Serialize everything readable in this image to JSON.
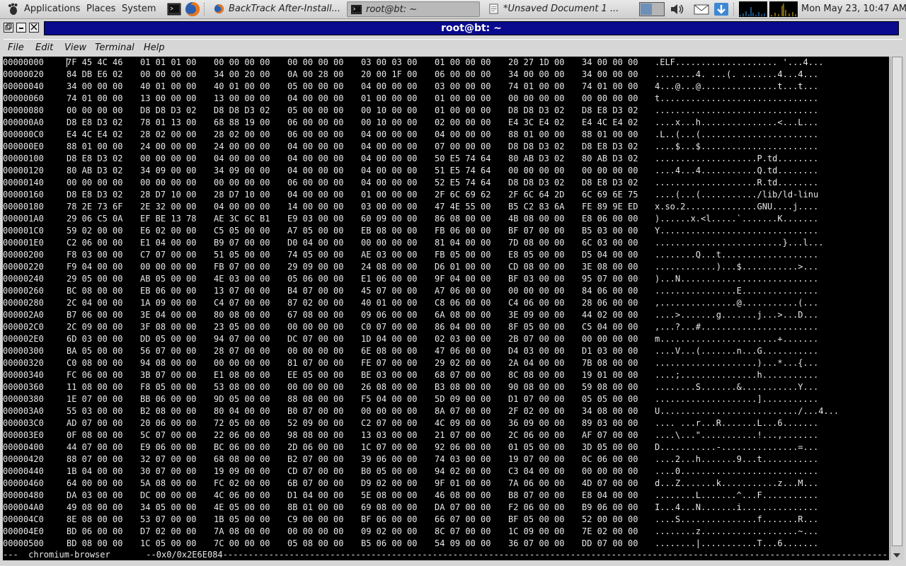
{
  "panel": {
    "menus": [
      "Applications",
      "Places",
      "System"
    ],
    "tasks": [
      {
        "label": "BackTrack After-Install...",
        "icon": "firefox-icon",
        "active": false
      },
      {
        "label": "root@bt: ~",
        "icon": "terminal-icon",
        "active": true
      },
      {
        "label": "*Unsaved Document 1 ...",
        "icon": "text-editor-icon",
        "active": false
      }
    ],
    "clock": "Mon May 23, 10:47 AM"
  },
  "window": {
    "title": "root@bt: ~",
    "menu": [
      "File",
      "Edit",
      "View",
      "Terminal",
      "Help"
    ]
  },
  "hexdump": {
    "rows": [
      {
        "addr": "00000000",
        "hex": [
          "7F 45 4C 46",
          "01 01 01 00",
          "00 00 00 00",
          "00 00 00 00",
          "03 00 03 00",
          "01 00 00 00",
          "20 27 1D 00",
          "34 00 00 00"
        ],
        "ascii": ".ELF.................... '...4..."
      },
      {
        "addr": "00000020",
        "hex": [
          "84 DB E6 02",
          "00 00 00 00",
          "34 00 20 00",
          "0A 00 28 00",
          "20 00 1F 00",
          "06 00 00 00",
          "34 00 00 00",
          "34 00 00 00"
        ],
        "ascii": "........4. ...(. .......4...4..."
      },
      {
        "addr": "00000040",
        "hex": [
          "34 00 00 00",
          "40 01 00 00",
          "40 01 00 00",
          "05 00 00 00",
          "04 00 00 00",
          "03 00 00 00",
          "74 01 00 00",
          "74 01 00 00"
        ],
        "ascii": "4...@...@...............t...t..."
      },
      {
        "addr": "00000060",
        "hex": [
          "74 01 00 00",
          "13 00 00 00",
          "13 00 00 00",
          "04 00 00 00",
          "01 00 00 00",
          "01 00 00 00",
          "00 00 00 00",
          "00 00 00 00"
        ],
        "ascii": "t..............................."
      },
      {
        "addr": "00000080",
        "hex": [
          "00 00 00 00",
          "D8 D8 D3 02",
          "D8 D8 D3 02",
          "05 00 00 00",
          "00 10 00 00",
          "01 00 00 00",
          "D8 D8 D3 02",
          "D8 E8 D3 02"
        ],
        "ascii": "................................"
      },
      {
        "addr": "000000A0",
        "hex": [
          "D8 E8 D3 02",
          "78 01 13 00",
          "68 88 19 00",
          "06 00 00 00",
          "00 10 00 00",
          "02 00 00 00",
          "E4 3C E4 02",
          "E4 4C E4 02"
        ],
        "ascii": "....x...h...............<...L..."
      },
      {
        "addr": "000000C0",
        "hex": [
          "E4 4C E4 02",
          "28 02 00 00",
          "28 02 00 00",
          "06 00 00 00",
          "04 00 00 00",
          "04 00 00 00",
          "88 01 00 00",
          "88 01 00 00"
        ],
        "ascii": ".L..(...(......................."
      },
      {
        "addr": "000000E0",
        "hex": [
          "88 01 00 00",
          "24 00 00 00",
          "24 00 00 00",
          "04 00 00 00",
          "04 00 00 00",
          "07 00 00 00",
          "D8 D8 D3 02",
          "D8 E8 D3 02"
        ],
        "ascii": "....$...$......................."
      },
      {
        "addr": "00000100",
        "hex": [
          "D8 E8 D3 02",
          "00 00 00 00",
          "04 00 00 00",
          "04 00 00 00",
          "04 00 00 00",
          "50 E5 74 64",
          "80 AB D3 02",
          "80 AB D3 02"
        ],
        "ascii": "....................P.td........"
      },
      {
        "addr": "00000120",
        "hex": [
          "80 AB D3 02",
          "34 09 00 00",
          "34 09 00 00",
          "04 00 00 00",
          "04 00 00 00",
          "51 E5 74 64",
          "00 00 00 00",
          "00 00 00 00"
        ],
        "ascii": "....4...4...........Q.td........"
      },
      {
        "addr": "00000140",
        "hex": [
          "00 00 00 00",
          "00 00 00 00",
          "00 00 00 00",
          "06 00 00 00",
          "04 00 00 00",
          "52 E5 74 64",
          "D8 D8 D3 02",
          "D8 E8 D3 02"
        ],
        "ascii": "....................R.td........"
      },
      {
        "addr": "00000160",
        "hex": [
          "D8 E8 D3 02",
          "28 D7 10 00",
          "28 D7 10 00",
          "04 00 00 00",
          "01 00 00 00",
          "2F 6C 69 62",
          "2F 6C 64 2D",
          "6C 69 6E 75"
        ],
        "ascii": "....(...(.........../lib/ld-linu"
      },
      {
        "addr": "00000180",
        "hex": [
          "78 2E 73 6F",
          "2E 32 00 00",
          "04 00 00 00",
          "14 00 00 00",
          "03 00 00 00",
          "47 4E 55 00",
          "B5 C2 83 6A",
          "FE 89 9E ED"
        ],
        "ascii": "x.so.2..............GNU....j...."
      },
      {
        "addr": "000001A0",
        "hex": [
          "29 06 C5 0A",
          "EF BE 13 78",
          "AE 3C 6C B1",
          "E9 03 00 00",
          "60 09 00 00",
          "86 08 00 00",
          "4B 08 00 00",
          "E8 06 00 00"
        ],
        "ascii": ")......x.<l.....`.......K......."
      },
      {
        "addr": "000001C0",
        "hex": [
          "59 02 00 00",
          "E6 02 00 00",
          "C5 05 00 00",
          "A7 05 00 00",
          "EB 08 00 00",
          "FB 06 00 00",
          "BF 07 00 00",
          "B5 03 00 00"
        ],
        "ascii": "Y..............................."
      },
      {
        "addr": "000001E0",
        "hex": [
          "C2 06 00 00",
          "E1 04 00 00",
          "B9 07 00 00",
          "D0 04 00 00",
          "00 00 00 00",
          "81 04 00 00",
          "7D 08 00 00",
          "6C 03 00 00"
        ],
        "ascii": ".........................}...l..."
      },
      {
        "addr": "00000200",
        "hex": [
          "F8 03 00 00",
          "C7 07 00 00",
          "51 05 00 00",
          "74 05 00 00",
          "AE 03 00 00",
          "FB 05 00 00",
          "E8 05 00 00",
          "D5 04 00 00"
        ],
        "ascii": "........Q...t..................."
      },
      {
        "addr": "00000220",
        "hex": [
          "F9 04 00 00",
          "00 00 00 00",
          "FB 07 00 00",
          "29 09 00 00",
          "24 08 00 00",
          "D6 01 00 00",
          "CD 08 00 00",
          "3E 08 00 00"
        ],
        "ascii": "............)...$...........>..."
      },
      {
        "addr": "00000240",
        "hex": [
          "29 05 00 00",
          "AB 05 00 00",
          "4E 03 00 00",
          "05 06 00 00",
          "E1 06 00 00",
          "9F 04 00 00",
          "BF 03 00 00",
          "95 07 00 00"
        ],
        "ascii": ")...N..........................."
      },
      {
        "addr": "00000260",
        "hex": [
          "BC 08 00 00",
          "EB 06 00 00",
          "13 07 00 00",
          "B4 07 00 00",
          "45 07 00 00",
          "A7 06 00 00",
          "00 00 00 00",
          "84 06 00 00"
        ],
        "ascii": "................E..............."
      },
      {
        "addr": "00000280",
        "hex": [
          "2C 04 00 00",
          "1A 09 00 00",
          "C4 07 00 00",
          "87 02 00 00",
          "40 01 00 00",
          "C8 06 00 00",
          "C4 06 00 00",
          "28 06 00 00"
        ],
        "ascii": ",...............@...........(..."
      },
      {
        "addr": "000002A0",
        "hex": [
          "B7 06 00 00",
          "3E 04 00 00",
          "80 08 00 00",
          "67 08 00 00",
          "09 06 00 00",
          "6A 08 00 00",
          "3E 09 00 00",
          "44 02 00 00"
        ],
        "ascii": "....>.......g.......j...>...D..."
      },
      {
        "addr": "000002C0",
        "hex": [
          "2C 09 00 00",
          "3F 08 00 00",
          "23 05 00 00",
          "00 00 00 00",
          "C0 07 00 00",
          "86 04 00 00",
          "8F 05 00 00",
          "C5 04 00 00"
        ],
        "ascii": ",...?...#......................."
      },
      {
        "addr": "000002E0",
        "hex": [
          "6D 03 00 00",
          "DD 05 00 00",
          "94 07 00 00",
          "DC 07 00 00",
          "1D 04 00 00",
          "02 03 00 00",
          "2B 07 00 00",
          "00 00 00 00"
        ],
        "ascii": "m.......................+......."
      },
      {
        "addr": "00000300",
        "hex": [
          "BA 05 00 00",
          "56 07 00 00",
          "28 07 00 00",
          "00 00 00 00",
          "6E 08 00 00",
          "47 06 00 00",
          "D4 03 00 00",
          "D1 03 00 00"
        ],
        "ascii": "....V...(.......n...G..........."
      },
      {
        "addr": "00000320",
        "hex": [
          "C0 08 00 00",
          "94 08 00 00",
          "00 00 00 00",
          "81 07 00 00",
          "FE 07 00 00",
          "29 02 00 00",
          "2A 04 00 00",
          "7B 08 00 00"
        ],
        "ascii": "....................)...*...{..."
      },
      {
        "addr": "00000340",
        "hex": [
          "FC 06 00 00",
          "3B 07 00 00",
          "E1 08 00 00",
          "EE 05 00 00",
          "BE 03 00 00",
          "68 07 00 00",
          "8C 08 00 00",
          "19 01 00 00"
        ],
        "ascii": "....;...............h..........."
      },
      {
        "addr": "00000360",
        "hex": [
          "11 08 00 00",
          "F8 05 00 00",
          "53 08 00 00",
          "00 00 00 00",
          "26 08 00 00",
          "B3 08 00 00",
          "90 08 00 00",
          "59 08 00 00"
        ],
        "ascii": "........S.......&...........Y..."
      },
      {
        "addr": "00000380",
        "hex": [
          "1E 07 00 00",
          "BB 06 00 00",
          "9D 05 00 00",
          "88 08 00 00",
          "F5 04 00 00",
          "5D 09 00 00",
          "D1 07 00 00",
          "05 05 00 00"
        ],
        "ascii": "....................]..........."
      },
      {
        "addr": "000003A0",
        "hex": [
          "55 03 00 00",
          "B2 08 00 00",
          "80 04 00 00",
          "B0 07 00 00",
          "00 00 00 00",
          "8A 07 00 00",
          "2F 02 00 00",
          "34 08 00 00"
        ],
        "ascii": "U.........................../...4..."
      },
      {
        "addr": "000003C0",
        "hex": [
          "AD 07 00 00",
          "20 06 00 00",
          "72 05 00 00",
          "52 09 00 00",
          "C2 07 00 00",
          "4C 09 00 00",
          "36 09 00 00",
          "89 03 00 00"
        ],
        "ascii": ".... ...r...R.......L...6......."
      },
      {
        "addr": "000003E0",
        "hex": [
          "0F 08 00 00",
          "5C 07 00 00",
          "22 06 00 00",
          "98 08 00 00",
          "13 03 00 00",
          "21 07 00 00",
          "2C 06 00 00",
          "AF 07 00 00"
        ],
        "ascii": "....\\...\"...........!...,......."
      },
      {
        "addr": "00000400",
        "hex": [
          "44 07 00 00",
          "E9 06 00 00",
          "BC 06 00 00",
          "2D 06 00 00",
          "1C 07 00 00",
          "92 06 00 00",
          "01 05 00 00",
          "3D 05 00 00"
        ],
        "ascii": "D...........-...............=..."
      },
      {
        "addr": "00000420",
        "hex": [
          "88 07 00 00",
          "32 07 00 00",
          "68 08 00 00",
          "B2 07 00 00",
          "39 06 00 00",
          "74 03 00 00",
          "19 07 00 00",
          "0C 06 00 00"
        ],
        "ascii": "....2...h.......9...t..........."
      },
      {
        "addr": "00000440",
        "hex": [
          "1B 04 00 00",
          "30 07 00 00",
          "19 09 00 00",
          "CD 07 00 00",
          "B0 05 00 00",
          "94 02 00 00",
          "C3 04 00 00",
          "00 00 00 00"
        ],
        "ascii": "....0..........................."
      },
      {
        "addr": "00000460",
        "hex": [
          "64 00 00 00",
          "5A 08 00 00",
          "FC 02 00 00",
          "6B 07 00 00",
          "D9 02 00 00",
          "9F 01 00 00",
          "7A 06 00 00",
          "4D 07 00 00"
        ],
        "ascii": "d...Z.......k...........z...M..."
      },
      {
        "addr": "00000480",
        "hex": [
          "DA 03 00 00",
          "DC 00 00 00",
          "4C 06 00 00",
          "D1 04 00 00",
          "5E 08 00 00",
          "46 08 00 00",
          "B8 07 00 00",
          "E8 04 00 00"
        ],
        "ascii": "........L.......^...F..........."
      },
      {
        "addr": "000004A0",
        "hex": [
          "49 08 00 00",
          "34 05 00 00",
          "4E 05 00 00",
          "8B 01 00 00",
          "69 08 00 00",
          "DA 07 00 00",
          "F2 06 00 00",
          "B9 06 00 00"
        ],
        "ascii": "I...4...N.......i..............."
      },
      {
        "addr": "000004C0",
        "hex": [
          "8E 08 00 00",
          "53 07 00 00",
          "1B 05 00 00",
          "C9 00 00 00",
          "BF 06 00 00",
          "66 07 00 00",
          "BF 05 00 00",
          "52 00 00 00"
        ],
        "ascii": "....S...............f.......R..."
      },
      {
        "addr": "000004E0",
        "hex": [
          "BD 06 00 00",
          "D7 02 00 00",
          "7A 08 00 00",
          "00 00 00 00",
          "09 02 00 00",
          "8C 07 00 00",
          "1C 09 00 00",
          "7E 02 00 00"
        ],
        "ascii": "........z...................~..."
      },
      {
        "addr": "00000500",
        "hex": [
          "BD 08 00 00",
          "1C 05 00 00",
          "7C 00 00 00",
          "05 08 00 00",
          "B5 06 00 00",
          "54 09 00 00",
          "36 07 00 00",
          "DD 07 00 00"
        ],
        "ascii": "........|...........T...6......."
      }
    ],
    "status": "---  chromium-browser       --0x0/0x2E6E084----------------------------------------------------------------------------------------------------------------------------------------------------"
  }
}
